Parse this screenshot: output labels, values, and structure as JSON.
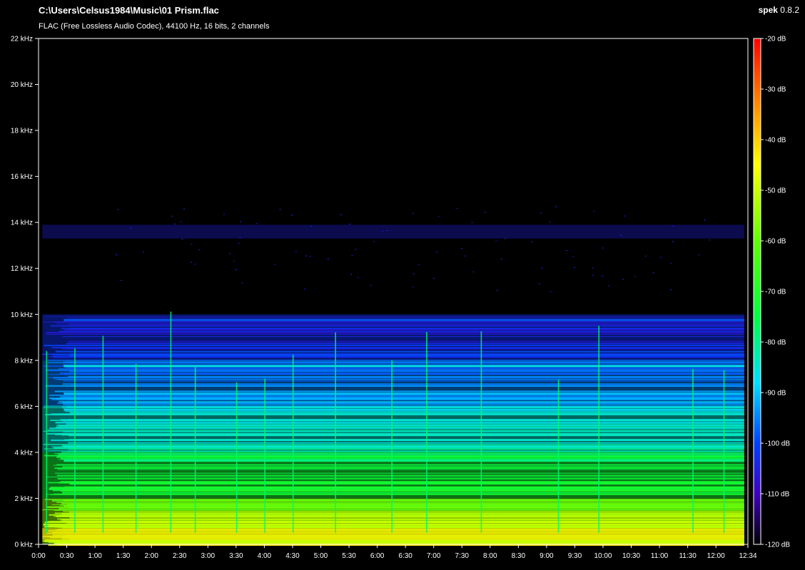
{
  "window": {
    "file_path": "C:\\Users\\Celsus1984\\Music\\01 Prism.flac",
    "app_name": "spek",
    "app_version": "0.8.2",
    "info": "FLAC (Free Lossless Audio Codec), 44100 Hz, 16 bits, 2 channels"
  },
  "chart_data": {
    "type": "heatmap",
    "title": "",
    "x_axis": {
      "unit": "time",
      "range": [
        "0:00",
        "12:34"
      ],
      "tick_labels": [
        "0:00",
        "0:30",
        "1:00",
        "1:30",
        "2:00",
        "2:30",
        "3:00",
        "3:30",
        "4:00",
        "4:30",
        "5:00",
        "5:30",
        "6:00",
        "6:30",
        "7:00",
        "7:30",
        "8:00",
        "8:30",
        "9:00",
        "9:30",
        "10:00",
        "10:30",
        "11:00",
        "11:30",
        "12:00",
        "12:34"
      ],
      "tick_seconds": [
        0,
        30,
        60,
        90,
        120,
        150,
        180,
        210,
        240,
        270,
        300,
        330,
        360,
        390,
        420,
        450,
        480,
        510,
        540,
        570,
        600,
        630,
        660,
        690,
        720,
        754
      ]
    },
    "y_axis": {
      "unit": "kHz",
      "range": [
        0,
        22
      ],
      "tick_labels": [
        "0 kHz",
        "2 kHz",
        "4 kHz",
        "6 kHz",
        "8 kHz",
        "10 kHz",
        "12 kHz",
        "14 kHz",
        "16 kHz",
        "18 kHz",
        "20 kHz",
        "22 kHz"
      ],
      "tick_values": [
        0,
        2,
        4,
        6,
        8,
        10,
        12,
        14,
        16,
        18,
        20,
        22
      ]
    },
    "color_scale": {
      "unit": "dB",
      "range": [
        -120,
        -20
      ],
      "tick_labels": [
        "-20 dB",
        "-30 dB",
        "-40 dB",
        "-50 dB",
        "-60 dB",
        "-70 dB",
        "-80 dB",
        "-90 dB",
        "-100 dB",
        "-110 dB",
        "-120 dB"
      ],
      "tick_values": [
        -20,
        -30,
        -40,
        -50,
        -60,
        -70,
        -80,
        -90,
        -100,
        -110,
        -120
      ],
      "colors": [
        "#ff0000",
        "#ff8000",
        "#ffff00",
        "#80ff00",
        "#00ff00",
        "#00ffc0",
        "#0080ff",
        "#2000ff",
        "#4000a0",
        "#000000"
      ]
    },
    "duration_seconds": 754,
    "energy_bands_khz": [
      {
        "low": 0,
        "high": 2,
        "level_db": -55
      },
      {
        "low": 2,
        "high": 4,
        "level_db": -72
      },
      {
        "low": 4,
        "high": 6,
        "level_db": -85
      },
      {
        "low": 6,
        "high": 8,
        "level_db": -95
      },
      {
        "low": 8,
        "high": 10,
        "level_db": -102
      },
      {
        "low": 13.3,
        "high": 13.9,
        "level_db": -105
      }
    ],
    "transient_seconds": [
      8,
      38,
      68,
      103,
      140,
      166,
      210,
      240,
      270,
      315,
      375,
      412,
      470,
      552,
      595,
      695,
      728
    ]
  }
}
